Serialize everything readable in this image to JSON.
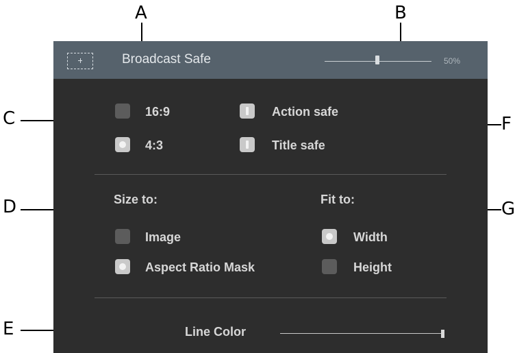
{
  "callouts": {
    "a": "A",
    "b": "B",
    "c": "C",
    "d": "D",
    "e": "E",
    "f": "F",
    "g": "G"
  },
  "header": {
    "icon": "frame-icon",
    "title": "Broadcast Safe",
    "opacity_value": "50%",
    "opacity_fraction": 0.5
  },
  "aspect": {
    "option_16_9": "16:9",
    "option_4_3": "4:3",
    "selected": "4:3"
  },
  "safe_areas": {
    "action_safe": "Action safe",
    "title_safe": "Title safe",
    "action_checked": true,
    "title_checked": true
  },
  "size_to": {
    "label": "Size to:",
    "image": "Image",
    "aspect_ratio_mask": "Aspect Ratio Mask",
    "selected": "Aspect Ratio Mask"
  },
  "fit_to": {
    "label": "Fit to:",
    "width": "Width",
    "height": "Height",
    "selected": "Width"
  },
  "line_color": {
    "label": "Line Color",
    "fraction": 1.0
  },
  "colors": {
    "header_bg": "#56626c",
    "panel_bg": "#2d2d2d",
    "text": "#d7d7d7",
    "control_on": "#c9c9c9",
    "control_off": "#5c5c5c"
  }
}
